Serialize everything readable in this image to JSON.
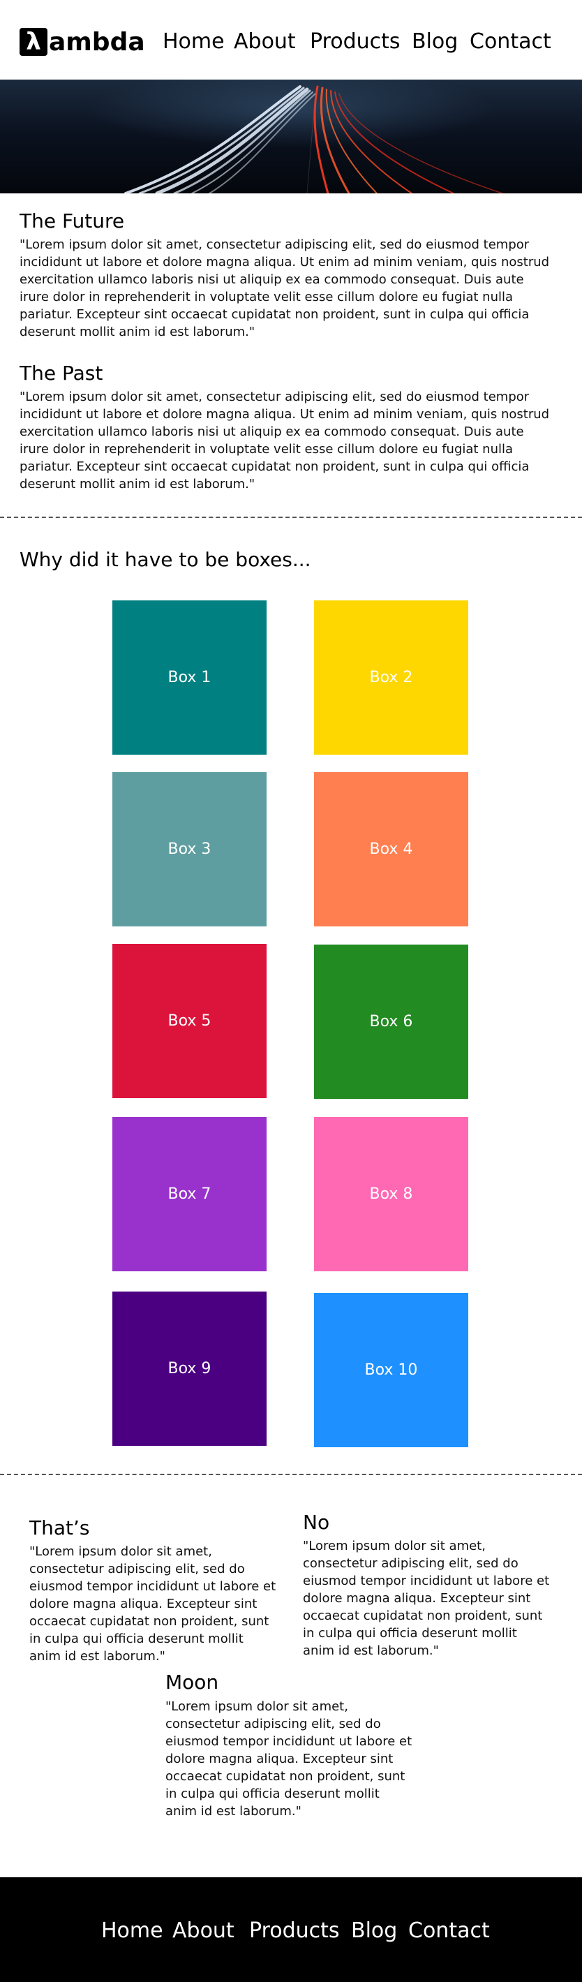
{
  "header": {
    "logo_mark": "λ",
    "logo_word": "ambda",
    "nav": [
      "Home",
      "About",
      "Products",
      "Blog",
      "Contact"
    ]
  },
  "sections": [
    {
      "title": "The Future",
      "text": "\"Lorem ipsum dolor sit amet, consectetur adipiscing elit, sed do eiusmod tempor incididunt ut labore et dolore magna aliqua. Ut enim ad minim veniam, quis nostrud exercitation ullamco laboris nisi ut aliquip ex ea commodo consequat. Duis aute irure dolor in reprehenderit in voluptate velit esse cillum dolore eu fugiat nulla pariatur. Excepteur sint occaecat cupidatat non proident, sunt in culpa qui officia deserunt mollit anim id est laborum.\""
    },
    {
      "title": "The Past",
      "text": "\"Lorem ipsum dolor sit amet, consectetur adipiscing elit, sed do eiusmod tempor incididunt ut labore et dolore magna aliqua. Ut enim ad minim veniam, quis nostrud exercitation ullamco laboris nisi ut aliquip ex ea commodo consequat. Duis aute irure dolor in reprehenderit in voluptate velit esse cillum dolore eu fugiat nulla pariatur. Excepteur sint occaecat cupidatat non proident, sunt in culpa qui officia deserunt mollit anim id est laborum.\""
    }
  ],
  "boxes_heading": "Why did it have to be boxes...",
  "boxes": [
    {
      "label": "Box 1",
      "color": "#008080"
    },
    {
      "label": "Box 2",
      "color": "#FFD700"
    },
    {
      "label": "Box 3",
      "color": "#5F9EA0"
    },
    {
      "label": "Box 4",
      "color": "#FF7F50"
    },
    {
      "label": "Box 5",
      "color": "#DC143C"
    },
    {
      "label": "Box 6",
      "color": "#228B22"
    },
    {
      "label": "Box 7",
      "color": "#9932CC"
    },
    {
      "label": "Box 8",
      "color": "#FF69B4"
    },
    {
      "label": "Box 9",
      "color": "#4B0082"
    },
    {
      "label": "Box 10",
      "color": "#1E90FF"
    }
  ],
  "cards": [
    {
      "title": "That’s",
      "text": "\"Lorem ipsum dolor sit amet, consectetur adipiscing elit, sed do eiusmod tempor incididunt ut labore et dolore magna aliqua. Excepteur sint occaecat cupidatat non proident, sunt in culpa qui officia deserunt mollit anim id est laborum.\""
    },
    {
      "title": "No",
      "text": "\"Lorem ipsum dolor sit amet, consectetur adipiscing elit, sed do eiusmod tempor incididunt ut labore et dolore magna aliqua. Excepteur sint occaecat cupidatat non proident, sunt in culpa qui officia deserunt mollit anim id est laborum.\""
    },
    {
      "title": "Moon",
      "text": "\"Lorem ipsum dolor sit amet, consectetur adipiscing elit, sed do eiusmod tempor incididunt ut labore et dolore magna aliqua. Excepteur sint occaecat cupidatat non proident, sunt in culpa qui officia deserunt mollit anim id est laborum.\""
    }
  ],
  "footer": {
    "nav": [
      "Home",
      "About",
      "Products",
      "Blog",
      "Contact"
    ]
  }
}
